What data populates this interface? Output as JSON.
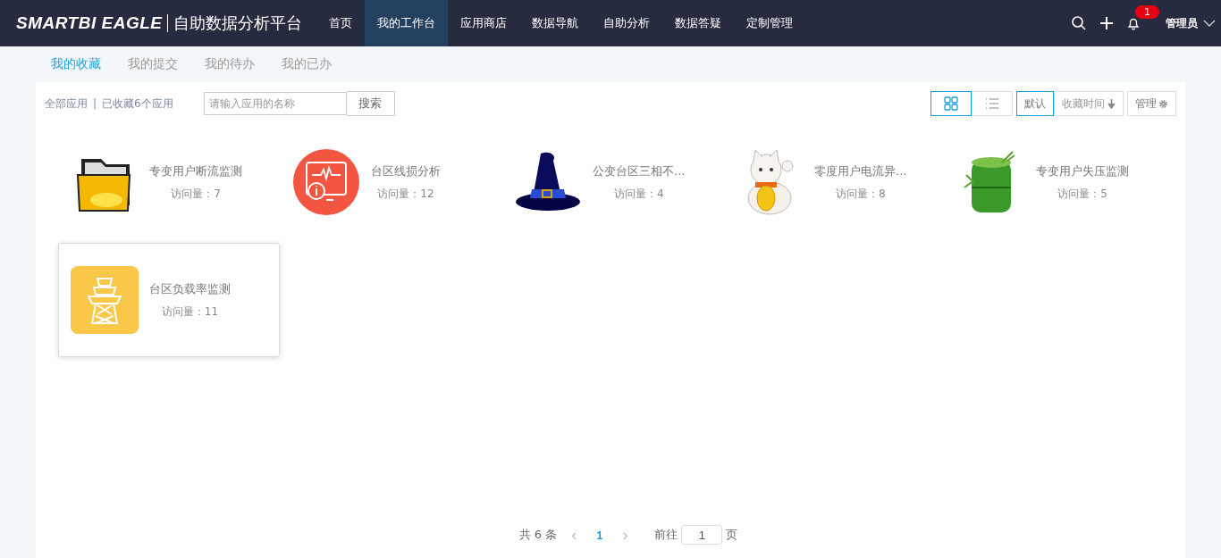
{
  "header": {
    "logo": "SMARTBI EAGLE",
    "platform_name": "自助数据分析平台",
    "nav": [
      {
        "label": "首页",
        "selected": false
      },
      {
        "label": "我的工作台",
        "selected": true
      },
      {
        "label": "应用商店",
        "selected": false
      },
      {
        "label": "数据导航",
        "selected": false
      },
      {
        "label": "自助分析",
        "selected": false
      },
      {
        "label": "数据答疑",
        "selected": false
      },
      {
        "label": "定制管理",
        "selected": false
      }
    ],
    "notification_count": "1",
    "user": "管理员"
  },
  "subtabs": [
    {
      "label": "我的收藏",
      "selected": true
    },
    {
      "label": "我的提交",
      "selected": false
    },
    {
      "label": "我的待办",
      "selected": false
    },
    {
      "label": "我的已办",
      "selected": false
    }
  ],
  "toolbar": {
    "all_apps": "全部应用",
    "separator": "|",
    "count": "已收藏6个应用",
    "search": {
      "placeholder": "请输入应用的名称"
    },
    "search_button": "搜索",
    "views": [
      {
        "kind": "grid",
        "selected": true
      },
      {
        "kind": "list",
        "selected": false
      }
    ],
    "sorts": [
      {
        "label": "默认",
        "selected": true
      },
      {
        "label": "收藏时间",
        "selected": false
      }
    ],
    "manage": "管理"
  },
  "apps": [
    {
      "kind": "folder",
      "name": "专变用户断流监测",
      "visits": "访问量：7",
      "highlighted": false
    },
    {
      "kind": "monitor",
      "name": "台区线损分析",
      "visits": "访问量：12",
      "highlighted": false
    },
    {
      "kind": "hat",
      "name": "公变台区三相不...",
      "visits": "访问量：4",
      "highlighted": false
    },
    {
      "kind": "cat",
      "name": "零度用户电流异...",
      "visits": "访问量：8",
      "highlighted": false
    },
    {
      "kind": "bamboo",
      "name": "专变用户失压监测",
      "visits": "访问量：5",
      "highlighted": false
    },
    {
      "kind": "tower",
      "name": "台区负载率监测",
      "visits": "访问量：11",
      "highlighted": true
    }
  ],
  "pagination": {
    "total": "共 6 条",
    "prev": "‹",
    "pages": [
      {
        "label": "1",
        "selected": true
      }
    ],
    "next": "›",
    "goto_label": "前往",
    "goto_value": "1",
    "page_unit": "页"
  }
}
